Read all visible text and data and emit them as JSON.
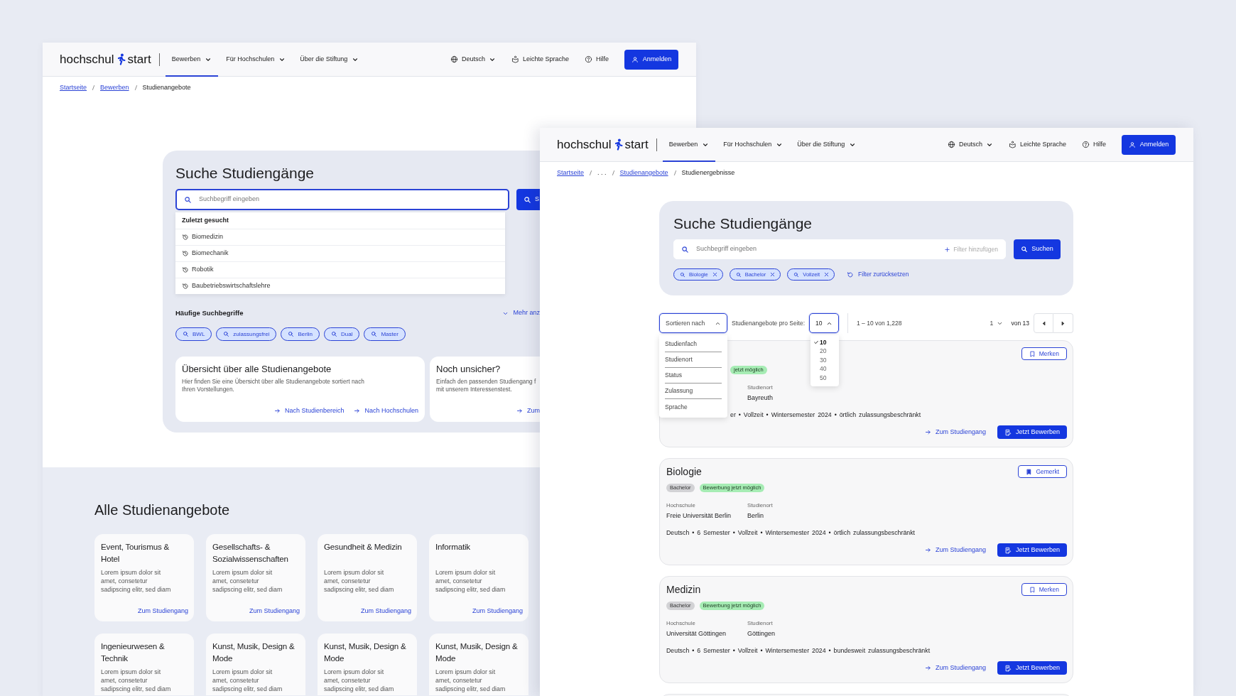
{
  "back_window": {
    "header": {
      "logo": {
        "left": "hochschul",
        "right": "start"
      },
      "nav": [
        {
          "label": "Bewerben",
          "selected": true
        },
        {
          "label": "Für Hochschulen",
          "selected": false
        },
        {
          "label": "Über die Stiftung",
          "selected": false
        }
      ],
      "language": "Deutsch",
      "easy_language": "Leichte Sprache",
      "help": "Hilfe",
      "login": "Anmelden"
    },
    "breadcrumb": [
      {
        "label": "Startseite",
        "link": true
      },
      {
        "label": "Bewerben",
        "link": true
      },
      {
        "label": "Studienangebote",
        "link": false
      }
    ],
    "search": {
      "title": "Suche Studiengänge",
      "placeholder": "Suchbegriff eingeben",
      "focused": true,
      "button": "S",
      "recent": {
        "heading": "Zuletzt gesucht",
        "items": [
          "Biomedizin",
          "Biomechanik",
          "Robotik",
          "Baubetriebswirtschaftslehre"
        ]
      },
      "popular": {
        "heading": "Häufige Suchbegriffe",
        "more": "Mehr anz",
        "chips": [
          "BWL",
          "zulassungsfrei",
          "Berlin",
          "Dual",
          "Master"
        ]
      },
      "teasers": [
        {
          "title": "Übersicht über alle Studienangebote",
          "text": "Hier finden Sie eine Übersicht über alle Studienangebote sortiert nach\nIhren Vorstellungen.",
          "links": [
            "Nach Studienbereich",
            "Nach Hochschulen"
          ]
        },
        {
          "title": "Noch unsicher?",
          "text": "Einfach den passenden Studiengang f\nmit unserem Interessenstest.",
          "links": [
            "Zum"
          ]
        }
      ]
    },
    "all_offers": {
      "title": "Alle Studienangebote",
      "cards": [
        {
          "title": "Event, Tourismus & Hotel",
          "text": "Lorem ipsum dolor sit\namet, consetetur\nsadipscing elitr, sed diam",
          "link": "Zum Studiengang"
        },
        {
          "title": "Gesellschafts- & Sozialwissenschaften",
          "text": "Lorem ipsum dolor sit\namet, consetetur\nsadipscing elitr, sed diam",
          "link": "Zum Studiengang"
        },
        {
          "title": "Gesundheit & Medizin",
          "text": "Lorem ipsum dolor sit\namet, consetetur\nsadipscing elitr, sed diam",
          "link": "Zum Studiengang"
        },
        {
          "title": "Informatik",
          "text": "Lorem ipsum dolor sit\namet, consetetur\nsadipscing elitr, sed diam",
          "link": "Zum Studiengang"
        },
        {
          "title": "Ingenieurwesen & Technik",
          "text": "Lorem ipsum dolor sit\namet, consetetur\nsadipscing elitr, sed diam"
        },
        {
          "title": "Kunst, Musik, Design & Mode",
          "text": "Lorem ipsum dolor sit\namet, consetetur\nsadipscing elitr, sed diam"
        },
        {
          "title": "Kunst, Musik, Design & Mode",
          "text": "Lorem ipsum dolor sit\namet, consetetur\nsadipscing elitr, sed diam"
        },
        {
          "title": "Kunst, Musik, Design & Mode",
          "text": "Lorem ipsum dolor sit\namet, consetetur\nsadipscing elitr, sed diam"
        }
      ]
    }
  },
  "front_window": {
    "header": {
      "logo": {
        "left": "hochschul",
        "right": "start"
      },
      "nav": [
        {
          "label": "Bewerben",
          "selected": true
        },
        {
          "label": "Für Hochschulen",
          "selected": false
        },
        {
          "label": "Über die Stiftung",
          "selected": false
        }
      ],
      "language": "Deutsch",
      "easy_language": "Leichte Sprache",
      "help": "Hilfe",
      "login": "Anmelden"
    },
    "breadcrumb": [
      {
        "label": "Startseite",
        "link": true
      },
      {
        "label": ". . .",
        "link": false
      },
      {
        "label": "Studienangebote",
        "link": true
      },
      {
        "label": "Studienergebnisse",
        "link": false
      }
    ],
    "search": {
      "title": "Suche Studiengänge",
      "placeholder": "Suchbegriff eingeben",
      "add_filter": "Filter hinzufügen",
      "button": "Suchen",
      "chips": [
        "Biologie",
        "Bachelor",
        "Vollzeit"
      ],
      "reset": "Filter zurücksetzen"
    },
    "toolbar": {
      "sort": {
        "label": "Sortieren nach",
        "open": true,
        "options": [
          "Studienfach",
          "Studienort",
          "Status",
          "Zulassung",
          "Sprache"
        ]
      },
      "per_page_label": "Studienangebote pro Seite:",
      "per_page": {
        "value": "10",
        "open": true,
        "options": [
          {
            "label": "10",
            "selected": true
          },
          {
            "label": "20",
            "selected": false
          },
          {
            "label": "30",
            "selected": false
          },
          {
            "label": "40",
            "selected": false
          },
          {
            "label": "50",
            "selected": false
          }
        ]
      },
      "range": "1 – 10 von 1,228",
      "page": "1",
      "page_total": "von 13"
    },
    "results": [
      {
        "covered": true,
        "saved": false,
        "save_label": "Merken",
        "badges": [
          {
            "text": "jetzt möglich",
            "kind": "status"
          }
        ],
        "fields": [
          {
            "label": "Studienort",
            "value": "Bayreuth"
          }
        ],
        "meta": "er • Vollzeit • Wintersemester 2024 • örtlich zulassungsbeschränkt",
        "link": "Zum Studiengang",
        "apply": "Jetzt Bewerben"
      },
      {
        "title": "Biologie",
        "saved": true,
        "save_label": "Gemerkt",
        "badges": [
          {
            "text": "Bachelor",
            "kind": "degree"
          },
          {
            "text": "Bewerbung jetzt möglich",
            "kind": "status"
          }
        ],
        "fields": [
          {
            "label": "Hochschule",
            "value": "Freie Universität Berlin"
          },
          {
            "label": "Studienort",
            "value": "Berlin"
          }
        ],
        "meta": "Deutsch • 6 Semester • Vollzeit • Wintersemester 2024 • örtlich zulassungsbeschränkt",
        "link": "Zum Studiengang",
        "apply": "Jetzt Bewerben"
      },
      {
        "title": "Medizin",
        "saved": false,
        "save_label": "Merken",
        "badges": [
          {
            "text": "Bachelor",
            "kind": "degree"
          },
          {
            "text": "Bewerbung jetzt möglich",
            "kind": "status"
          }
        ],
        "fields": [
          {
            "label": "Hochschule",
            "value": "Universität Göttingen"
          },
          {
            "label": "Studienort",
            "value": "Göttingen"
          }
        ],
        "meta": "Deutsch • 6 Semester • Vollzeit • Wintersemester 2024 • bundesweit zulassungsbeschränkt",
        "link": "Zum Studiengang",
        "apply": "Jetzt Bewerben"
      }
    ]
  }
}
